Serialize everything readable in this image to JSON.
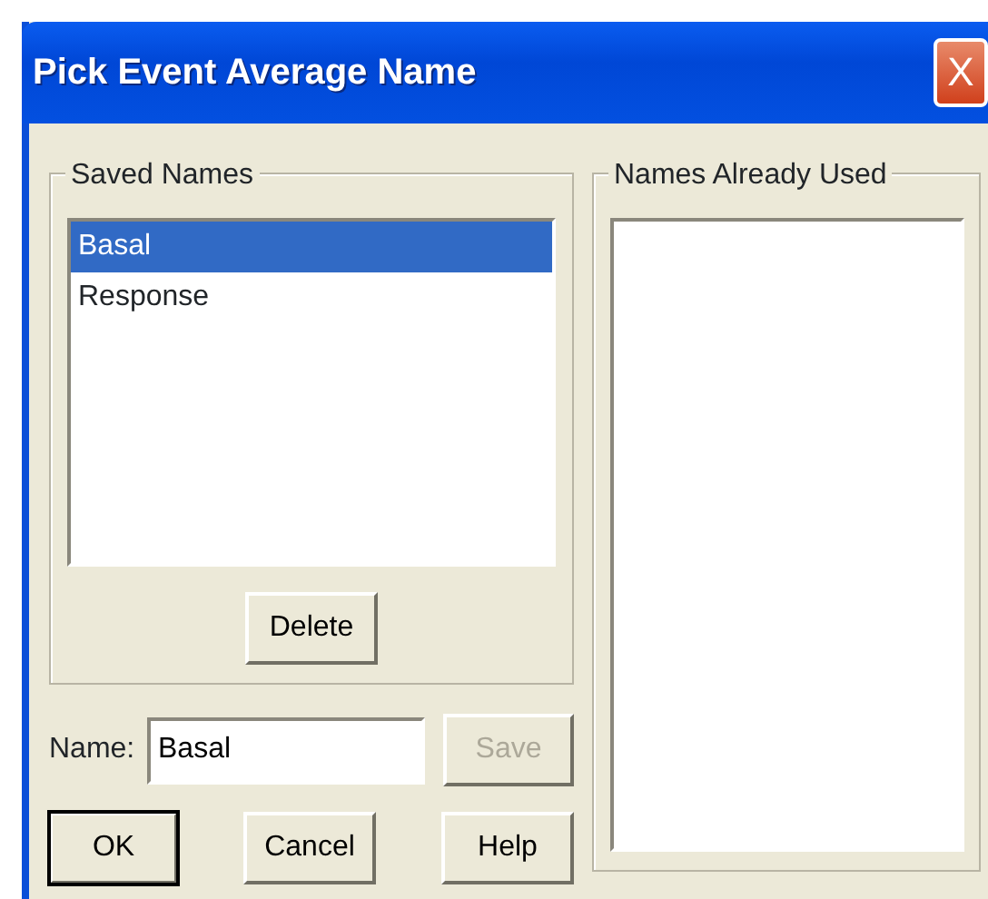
{
  "window": {
    "title": "Pick Event Average Name",
    "close": "X"
  },
  "saved_names": {
    "label": "Saved Names",
    "items": [
      {
        "text": "Basal",
        "selected": true
      },
      {
        "text": "Response",
        "selected": false
      }
    ],
    "delete_button": {
      "label": "Delete",
      "disabled": false
    }
  },
  "names_already_used": {
    "label": "Names Already Used"
  },
  "name_field": {
    "label": "Name:",
    "value": "Basal"
  },
  "save_button": {
    "label": "Save",
    "disabled": true
  },
  "buttons": [
    {
      "label": "OK",
      "default": true
    },
    {
      "label": "Cancel",
      "default": false
    },
    {
      "label": "Help",
      "default": false
    }
  ]
}
